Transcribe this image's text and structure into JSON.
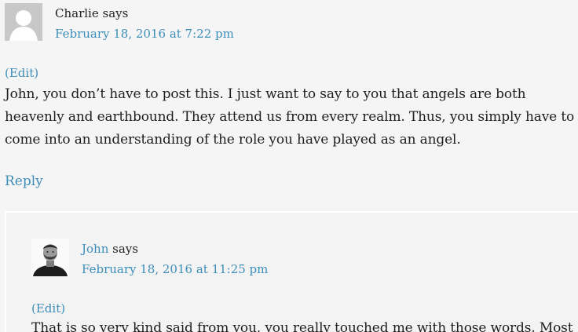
{
  "comments": [
    {
      "author": "Charlie",
      "says": "says",
      "date": "February 18, 2016 at 7:22 pm",
      "edit_label": "(Edit)",
      "body": "John, you don’t have to post this. I just want to say to you that angels are both heavenly and earthbound. They attend us from every realm. Thus, you simply have to come into an understanding of the role you have played as an angel.",
      "reply_label": "Reply",
      "avatar": "default-user-avatar"
    },
    {
      "author": "John",
      "says": "says",
      "date": "February 18, 2016 at 11:25 pm",
      "edit_label": "(Edit)",
      "body": "That is so very kind said from you, you really touched me with those words. Most",
      "avatar": "user-photo-avatar"
    }
  ],
  "colors": {
    "link": "#3d8eb9",
    "text": "#222222",
    "background": "#f5f5f5"
  }
}
